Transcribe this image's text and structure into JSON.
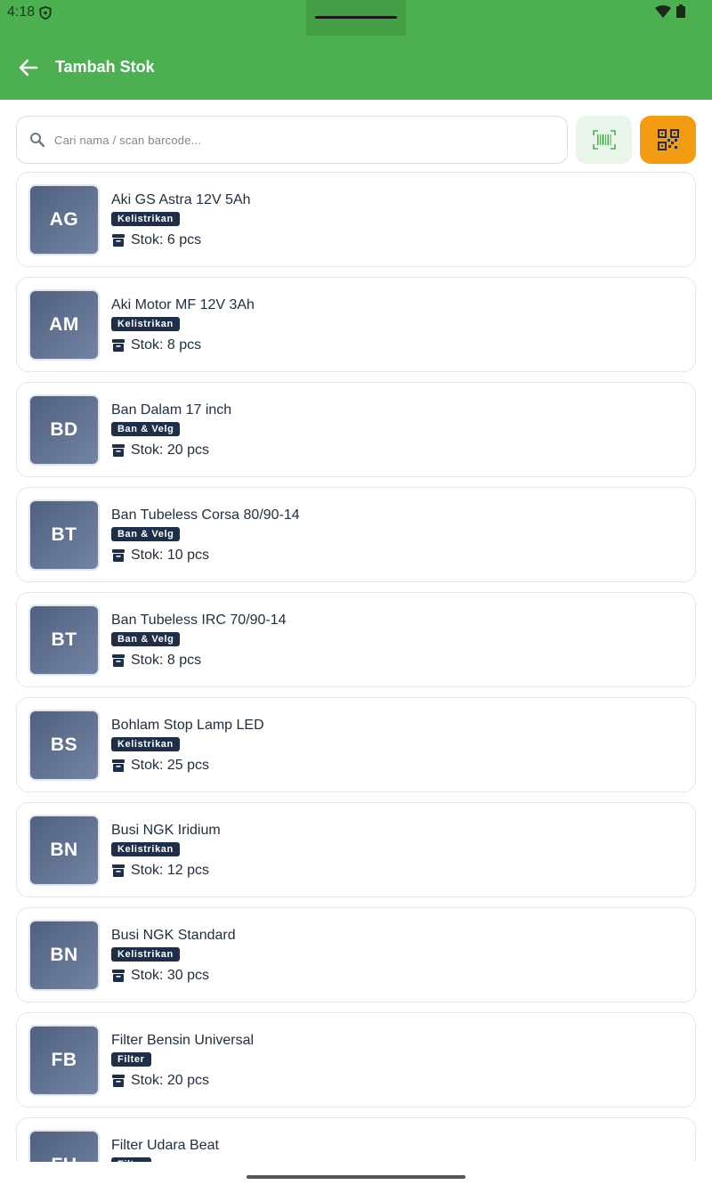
{
  "status": {
    "time": "4:18"
  },
  "appbar": {
    "title": "Tambah Stok",
    "back_icon": "arrow-left-icon"
  },
  "search": {
    "placeholder": "Cari nama / scan barcode...",
    "value": ""
  },
  "buttons": {
    "barcode_icon": "barcode-icon",
    "qr_icon": "qr-code-icon"
  },
  "stock_label": "Stok",
  "items": [
    {
      "initials": "AG",
      "name": "Aki GS Astra 12V 5Ah",
      "category": "Kelistrikan",
      "stock": "Stok: 6 pcs"
    },
    {
      "initials": "AM",
      "name": "Aki Motor MF 12V 3Ah",
      "category": "Kelistrikan",
      "stock": "Stok: 8 pcs"
    },
    {
      "initials": "BD",
      "name": "Ban Dalam 17 inch",
      "category": "Ban & Velg",
      "stock": "Stok: 20 pcs"
    },
    {
      "initials": "BT",
      "name": "Ban Tubeless Corsa 80/90-14",
      "category": "Ban & Velg",
      "stock": "Stok: 10 pcs"
    },
    {
      "initials": "BT",
      "name": "Ban Tubeless IRC 70/90-14",
      "category": "Ban & Velg",
      "stock": "Stok: 8 pcs"
    },
    {
      "initials": "BS",
      "name": "Bohlam Stop Lamp LED",
      "category": "Kelistrikan",
      "stock": "Stok: 25 pcs"
    },
    {
      "initials": "BN",
      "name": "Busi NGK Iridium",
      "category": "Kelistrikan",
      "stock": "Stok: 12 pcs"
    },
    {
      "initials": "BN",
      "name": "Busi NGK Standard",
      "category": "Kelistrikan",
      "stock": "Stok: 30 pcs"
    },
    {
      "initials": "FB",
      "name": "Filter Bensin Universal",
      "category": "Filter",
      "stock": "Stok: 20 pcs"
    },
    {
      "initials": "FU",
      "name": "Filter Udara Beat",
      "category": "Filter",
      "stock": ""
    }
  ],
  "colors": {
    "primary": "#4caf50",
    "accent": "#f39c12",
    "badge": "#1e2f4a"
  }
}
